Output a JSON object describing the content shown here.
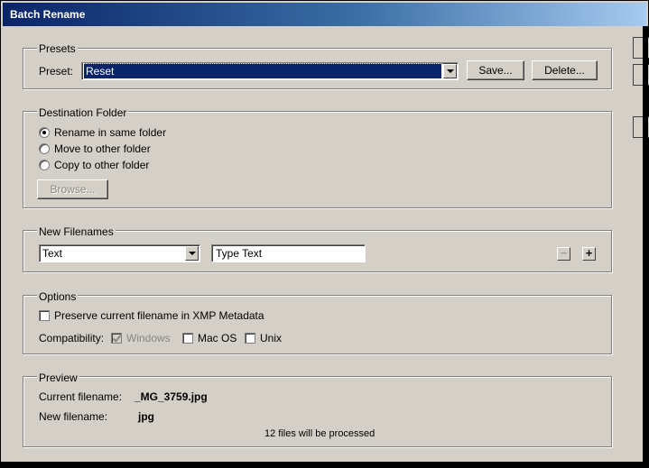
{
  "window": {
    "title": "Batch Rename"
  },
  "presets": {
    "group_title": "Presets",
    "preset_label": "Preset:",
    "preset_value": "Reset",
    "save_label": "Save...",
    "delete_label": "Delete..."
  },
  "destination": {
    "group_title": "Destination Folder",
    "options": [
      {
        "label": "Rename in same folder",
        "selected": true
      },
      {
        "label": "Move to other folder",
        "selected": false
      },
      {
        "label": "Copy to other folder",
        "selected": false
      }
    ],
    "browse_label": "Browse..."
  },
  "new_filenames": {
    "group_title": "New Filenames",
    "type_value": "Text",
    "text_value": "Type Text",
    "remove_icon": "minus-icon",
    "add_icon": "plus-icon",
    "remove_glyph": "−",
    "add_glyph": "+"
  },
  "options": {
    "group_title": "Options",
    "preserve_label": "Preserve current filename in XMP Metadata",
    "preserve_checked": false,
    "compat_label": "Compatibility:",
    "windows_label": "Windows",
    "windows_checked": true,
    "mac_label": "Mac OS",
    "mac_checked": false,
    "unix_label": "Unix",
    "unix_checked": false
  },
  "preview": {
    "group_title": "Preview",
    "current_label": "Current filename:",
    "current_value": "_MG_3759.jpg",
    "new_label": "New filename:",
    "new_value": "jpg",
    "status": "12 files will be processed"
  }
}
